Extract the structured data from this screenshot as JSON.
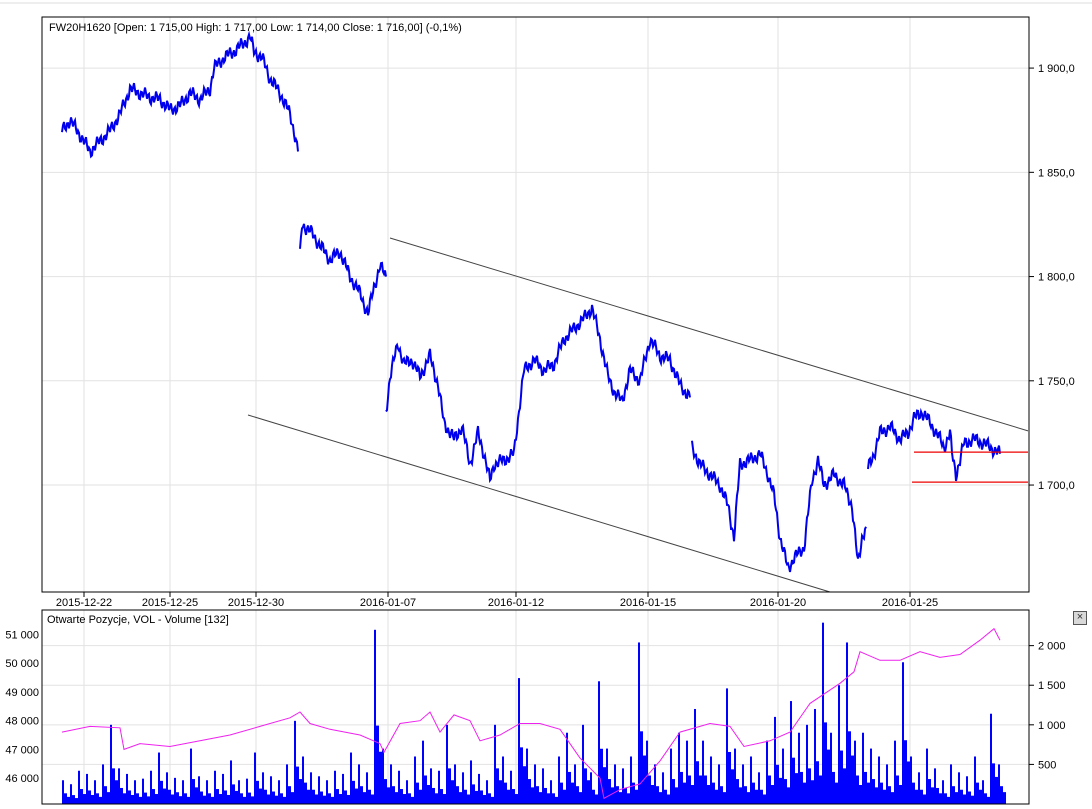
{
  "chart_data": [
    {
      "type": "line",
      "title": "FW20H1620 [Open: 1 715,00  High: 1 717,00  Low: 1 714,00  Close: 1 716,00] (-0,1%)",
      "ylim": [
        1648.7,
        1924.5
      ],
      "y_ticks": [
        {
          "v": 1900,
          "label": "1 900,0"
        },
        {
          "v": 1850,
          "label": "1 850,0"
        },
        {
          "v": 1800,
          "label": "1 800,0"
        },
        {
          "v": 1750,
          "label": "1 750,0"
        },
        {
          "v": 1700,
          "label": "1 700,0"
        }
      ],
      "x_ticks": [
        {
          "i": 11,
          "label": "2015-12-22"
        },
        {
          "i": 54,
          "label": "2015-12-25"
        },
        {
          "i": 97,
          "label": "2015-12-30"
        },
        {
          "i": 163,
          "label": "2016-01-07"
        },
        {
          "i": 227,
          "label": "2016-01-12"
        },
        {
          "i": 293,
          "label": "2016-01-15"
        },
        {
          "i": 358,
          "label": "2016-01-20"
        },
        {
          "i": 424,
          "label": "2016-01-25"
        }
      ],
      "x_range": [
        -10,
        484
      ],
      "series_color": "#0000ee",
      "segments": [
        [
          [
            0,
            1870
          ],
          [
            4,
            1875
          ],
          [
            9,
            1868
          ],
          [
            14,
            1860
          ],
          [
            19,
            1865
          ],
          [
            24,
            1870
          ],
          [
            29,
            1878
          ],
          [
            34,
            1890
          ],
          [
            39,
            1888
          ],
          [
            44,
            1886
          ],
          [
            49,
            1885
          ],
          [
            54,
            1880
          ],
          [
            59,
            1882
          ],
          [
            64,
            1888
          ],
          [
            69,
            1885
          ],
          [
            74,
            1890
          ],
          [
            76,
            1900
          ],
          [
            81,
            1905
          ],
          [
            86,
            1908
          ],
          [
            91,
            1912
          ],
          [
            94,
            1915
          ],
          [
            96,
            1908
          ],
          [
            100,
            1905
          ],
          [
            104,
            1895
          ],
          [
            109,
            1888
          ],
          [
            114,
            1878
          ],
          [
            116,
            1870
          ],
          [
            118,
            1860
          ]
        ],
        [
          [
            119,
            1810
          ],
          [
            120,
            1825
          ],
          [
            124,
            1822
          ],
          [
            129,
            1815
          ],
          [
            134,
            1808
          ],
          [
            139,
            1812
          ],
          [
            144,
            1800
          ],
          [
            149,
            1792
          ],
          [
            153,
            1782
          ],
          [
            156,
            1795
          ],
          [
            159,
            1805
          ],
          [
            162,
            1800
          ]
        ],
        [
          [
            162,
            1735
          ],
          [
            164,
            1752
          ],
          [
            168,
            1768
          ],
          [
            171,
            1758
          ],
          [
            175,
            1760
          ],
          [
            179,
            1752
          ],
          [
            184,
            1762
          ],
          [
            188,
            1748
          ],
          [
            191,
            1730
          ],
          [
            196,
            1722
          ],
          [
            200,
            1728
          ],
          [
            204,
            1710
          ],
          [
            208,
            1725
          ],
          [
            211,
            1715
          ],
          [
            214,
            1702
          ],
          [
            216,
            1710
          ],
          [
            221,
            1712
          ],
          [
            226,
            1715
          ],
          [
            229,
            1740
          ],
          [
            231,
            1755
          ],
          [
            236,
            1760
          ],
          [
            241,
            1755
          ],
          [
            246,
            1758
          ],
          [
            251,
            1770
          ],
          [
            256,
            1775
          ],
          [
            261,
            1780
          ],
          [
            265,
            1785
          ],
          [
            269,
            1770
          ],
          [
            273,
            1752
          ],
          [
            276,
            1745
          ],
          [
            280,
            1740
          ],
          [
            284,
            1755
          ],
          [
            289,
            1750
          ],
          [
            294,
            1770
          ],
          [
            299,
            1762
          ],
          [
            304,
            1760
          ],
          [
            309,
            1748
          ],
          [
            314,
            1742
          ]
        ],
        [
          [
            315,
            1718
          ],
          [
            319,
            1710
          ],
          [
            324,
            1705
          ],
          [
            329,
            1700
          ],
          [
            333,
            1690
          ],
          [
            336,
            1675
          ],
          [
            339,
            1710
          ],
          [
            344,
            1712
          ],
          [
            349,
            1715
          ],
          [
            353,
            1705
          ],
          [
            356,
            1695
          ],
          [
            359,
            1675
          ],
          [
            363,
            1660
          ],
          [
            366,
            1665
          ],
          [
            371,
            1670
          ],
          [
            375,
            1702
          ],
          [
            378,
            1712
          ],
          [
            381,
            1700
          ],
          [
            386,
            1705
          ],
          [
            391,
            1700
          ],
          [
            395,
            1690
          ],
          [
            398,
            1662
          ],
          [
            400,
            1675
          ],
          [
            402,
            1680
          ]
        ],
        [
          [
            403,
            1708
          ],
          [
            406,
            1715
          ],
          [
            409,
            1725
          ],
          [
            414,
            1728
          ],
          [
            419,
            1722
          ],
          [
            423,
            1725
          ],
          [
            426,
            1732
          ],
          [
            430,
            1735
          ],
          [
            434,
            1730
          ],
          [
            439,
            1722
          ],
          [
            441,
            1718
          ],
          [
            444,
            1725
          ],
          [
            445,
            1715
          ],
          [
            447,
            1705
          ],
          [
            449,
            1712
          ],
          [
            451,
            1720
          ],
          [
            456,
            1722
          ],
          [
            461,
            1720
          ],
          [
            466,
            1717
          ],
          [
            469,
            1715
          ]
        ]
      ],
      "trend_lines": [
        {
          "from": [
            164,
            1818.5
          ],
          "to": [
            483,
            1726
          ],
          "color": "#444444"
        },
        {
          "from": [
            93,
            1733.6
          ],
          "to": [
            384,
            1648.7
          ],
          "color": "#444444"
        }
      ],
      "levels": [
        {
          "from": 426,
          "to": 483,
          "value": 1715.8,
          "color": "#ee0000"
        },
        {
          "from": 425,
          "to": 483,
          "value": 1701.4,
          "color": "#ee0000"
        }
      ]
    },
    {
      "type": "bar",
      "title": "Otwarte Pozycje, VOL - Volume [132]",
      "volume_color": "#0000ff",
      "oi_color": "#ee22ee",
      "volume_ylim": [
        0,
        2450
      ],
      "oi_ylim": [
        45100,
        51850
      ],
      "volume_ticks": [
        {
          "v": 2000,
          "label": "2 000"
        },
        {
          "v": 1500,
          "label": "1 500"
        },
        {
          "v": 1000,
          "label": "1 000"
        },
        {
          "v": 500,
          "label": "500"
        }
      ],
      "oi_ticks": [
        {
          "v": 51000,
          "label": "51 000"
        },
        {
          "v": 50000,
          "label": "50 000"
        },
        {
          "v": 49000,
          "label": "49 000"
        },
        {
          "v": 48000,
          "label": "48 000"
        },
        {
          "v": 47000,
          "label": "47 000"
        },
        {
          "v": 46000,
          "label": "46 000"
        }
      ],
      "volume": [
        300,
        250,
        420,
        380,
        300,
        500,
        1000,
        450,
        380,
        300,
        320,
        420,
        650,
        400,
        330,
        300,
        700,
        350,
        300,
        420,
        380,
        550,
        300,
        320,
        650,
        400,
        350,
        300,
        500,
        1050,
        600,
        400,
        350,
        300,
        420,
        380,
        650,
        500,
        400,
        2200,
        700,
        500,
        420,
        300,
        600,
        800,
        450,
        420,
        1000,
        500,
        400,
        550,
        380,
        300,
        1000,
        600,
        420,
        1590,
        700,
        500,
        450,
        300,
        600,
        900,
        500,
        1000,
        400,
        1550,
        700,
        500,
        450,
        600,
        2040,
        800,
        500,
        400,
        700,
        900,
        800,
        1200,
        800,
        600,
        500,
        1460,
        700,
        500,
        600,
        400,
        800,
        1100,
        700,
        1300,
        900,
        1000,
        1200,
        2290,
        900,
        1500,
        2040,
        800,
        900,
        700,
        600,
        500,
        800,
        1790,
        600,
        400,
        700,
        450,
        300,
        500,
        400,
        350,
        600,
        300,
        1140,
        500
      ],
      "open_interest": [
        [
          0,
          47600
        ],
        [
          14,
          47800
        ],
        [
          29,
          47750
        ],
        [
          31,
          47000
        ],
        [
          39,
          47200
        ],
        [
          54,
          47100
        ],
        [
          69,
          47300
        ],
        [
          84,
          47500
        ],
        [
          99,
          47800
        ],
        [
          114,
          48100
        ],
        [
          119,
          48300
        ],
        [
          124,
          47900
        ],
        [
          134,
          47700
        ],
        [
          149,
          47500
        ],
        [
          159,
          47200
        ],
        [
          161,
          46900
        ],
        [
          169,
          47900
        ],
        [
          179,
          48000
        ],
        [
          184,
          48300
        ],
        [
          189,
          47600
        ],
        [
          196,
          48200
        ],
        [
          204,
          48000
        ],
        [
          209,
          47300
        ],
        [
          219,
          47500
        ],
        [
          229,
          47900
        ],
        [
          239,
          47900
        ],
        [
          249,
          47700
        ],
        [
          259,
          46700
        ],
        [
          269,
          46000
        ],
        [
          271,
          45300
        ],
        [
          279,
          45600
        ],
        [
          289,
          45800
        ],
        [
          299,
          46600
        ],
        [
          309,
          47600
        ],
        [
          324,
          47900
        ],
        [
          334,
          47800
        ],
        [
          341,
          47100
        ],
        [
          354,
          47300
        ],
        [
          364,
          47600
        ],
        [
          374,
          48600
        ],
        [
          389,
          49300
        ],
        [
          396,
          49700
        ],
        [
          399,
          50400
        ],
        [
          409,
          50100
        ],
        [
          419,
          50100
        ],
        [
          429,
          50400
        ],
        [
          439,
          50200
        ],
        [
          449,
          50300
        ],
        [
          459,
          50800
        ],
        [
          466,
          51200
        ],
        [
          469,
          50800
        ]
      ]
    }
  ],
  "controls": {
    "close_panel": "×"
  }
}
